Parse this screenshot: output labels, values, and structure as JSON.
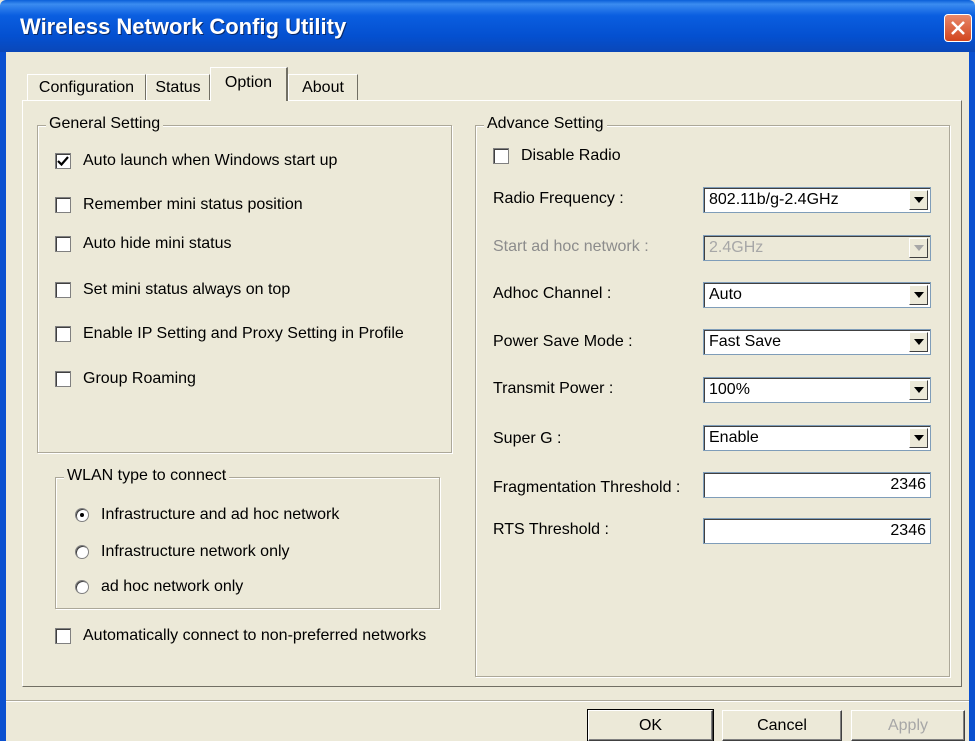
{
  "window": {
    "title": "Wireless Network Config Utility"
  },
  "tabs": [
    {
      "label": "Configuration"
    },
    {
      "label": "Status"
    },
    {
      "label": "Option"
    },
    {
      "label": "About"
    }
  ],
  "general": {
    "legend": "General Setting",
    "items": [
      {
        "label": "Auto launch when Windows start up",
        "checked": true
      },
      {
        "label": "Remember mini status position",
        "checked": false
      },
      {
        "label": "Auto hide mini status",
        "checked": false
      },
      {
        "label": "Set mini status always on top",
        "checked": false
      },
      {
        "label": "Enable IP Setting and Proxy Setting in Profile",
        "checked": false
      },
      {
        "label": "Group Roaming",
        "checked": false
      }
    ]
  },
  "wlan": {
    "legend": "WLAN type to connect",
    "options": [
      {
        "label": "Infrastructure and ad hoc network",
        "selected": true
      },
      {
        "label": "Infrastructure network only",
        "selected": false
      },
      {
        "label": "ad hoc network only",
        "selected": false
      }
    ]
  },
  "auto_connect": {
    "label": "Automatically connect to non-preferred networks",
    "checked": false
  },
  "advance": {
    "legend": "Advance Setting",
    "disable_radio": {
      "label": "Disable Radio",
      "checked": false
    },
    "radio_frequency": {
      "label": "Radio Frequency :",
      "value": "802.11b/g-2.4GHz"
    },
    "start_adhoc": {
      "label": "Start ad hoc network :",
      "value": "2.4GHz"
    },
    "adhoc_channel": {
      "label": "Adhoc Channel :",
      "value": "Auto"
    },
    "power_save": {
      "label": "Power Save Mode :",
      "value": "Fast Save"
    },
    "transmit_power": {
      "label": "Transmit Power :",
      "value": "100%"
    },
    "super_g": {
      "label": "Super G :",
      "value": "Enable"
    },
    "frag_threshold": {
      "label": "Fragmentation Threshold :",
      "value": "2346"
    },
    "rts_threshold": {
      "label": "RTS Threshold :",
      "value": "2346"
    }
  },
  "buttons": {
    "ok": "OK",
    "cancel": "Cancel",
    "apply": "Apply"
  }
}
